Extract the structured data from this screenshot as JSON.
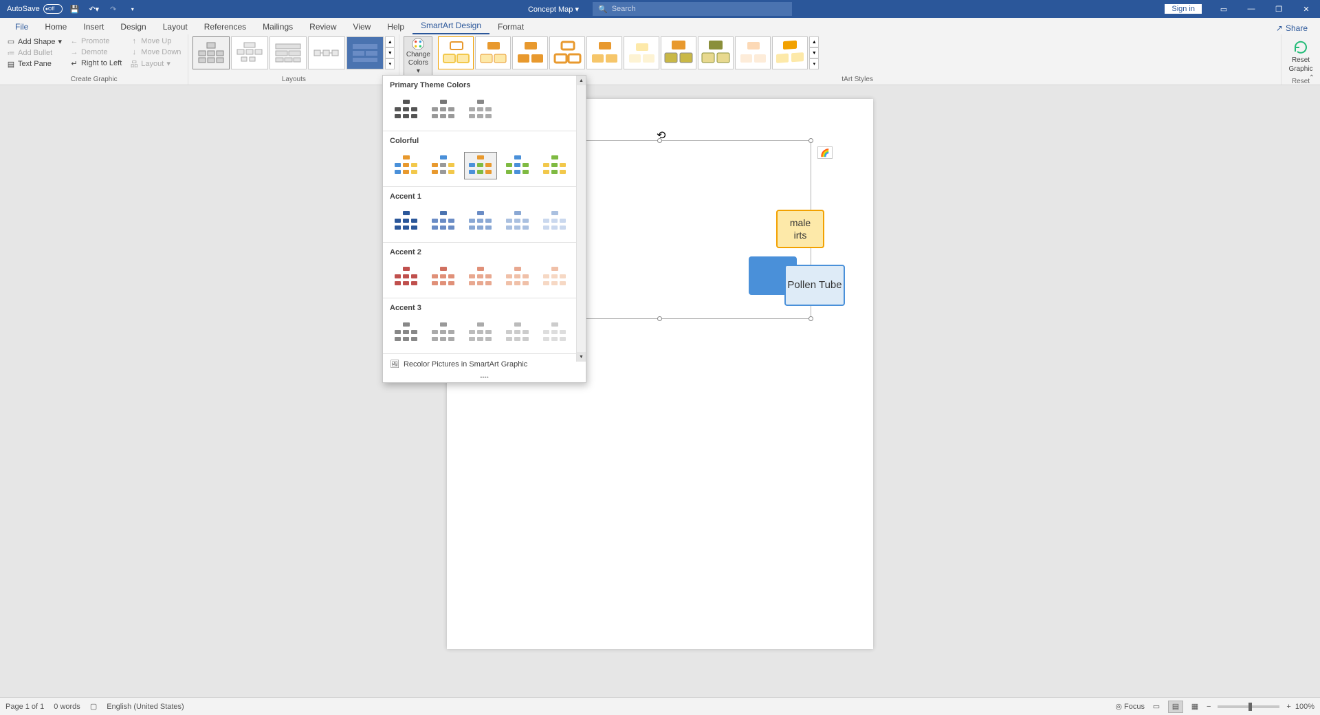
{
  "titlebar": {
    "autosave_label": "AutoSave",
    "autosave_state": "Off",
    "doc_title": "Concept Map",
    "search_placeholder": "Search",
    "signin_label": "Sign in"
  },
  "tabs": {
    "file": "File",
    "home": "Home",
    "insert": "Insert",
    "design": "Design",
    "layout": "Layout",
    "references": "References",
    "mailings": "Mailings",
    "review": "Review",
    "view": "View",
    "help": "Help",
    "smartart": "SmartArt Design",
    "format": "Format",
    "share": "Share"
  },
  "ribbon": {
    "create_graphic": {
      "label": "Create Graphic",
      "add_shape": "Add Shape",
      "add_bullet": "Add Bullet",
      "text_pane": "Text Pane",
      "promote": "Promote",
      "demote": "Demote",
      "right_to_left": "Right to Left",
      "move_up": "Move Up",
      "move_down": "Move Down",
      "layout_btn": "Layout"
    },
    "layouts": {
      "label": "Layouts"
    },
    "change_colors": "Change Colors",
    "styles": {
      "label": "tArt Styles"
    },
    "reset": {
      "label": "Reset",
      "button": "Reset Graphic"
    }
  },
  "dropdown": {
    "sections": {
      "primary": "Primary Theme Colors",
      "colorful": "Colorful",
      "accent1": "Accent 1",
      "accent2": "Accent 2",
      "accent3": "Accent 3"
    },
    "recolor": "Recolor Pictures in SmartArt Graphic"
  },
  "smartart": {
    "node_female": "male\nirts",
    "node_pollen": "Pollen Tube"
  },
  "statusbar": {
    "page": "Page 1 of 1",
    "words": "0 words",
    "language": "English (United States)",
    "focus": "Focus",
    "zoom": "100%"
  }
}
